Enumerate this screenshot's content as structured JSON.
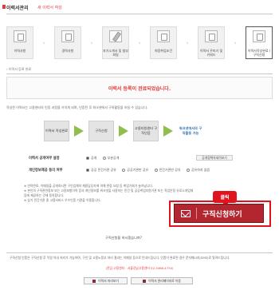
{
  "header": {
    "title": "이력서관리",
    "subtitle": "새 이력서 작성"
  },
  "steps": [
    {
      "label": "이력사항"
    },
    {
      "label": "경력사항"
    },
    {
      "label": "자기소개서 및 첨부파일"
    },
    {
      "label": "희망취업조건"
    },
    {
      "label": "이력서 꾸미기 및 키워드"
    },
    {
      "label": "이력서작성완료 /구직신청"
    }
  ],
  "sub_note": "› 이력서 등록 완료",
  "done_message": "이력서 등록이 완료되었습니다.",
  "info_line": "작성된 이력서는 고용센터의 인증 과정을 거치게 되며, 인증된 후 워크넷에서 구직활동을 하실 수 있습니다.",
  "pipeline": [
    "이력서 작성완료",
    "구직신청",
    "고용지원센터 구직인증",
    "워크넷에서의 구직활동 가능"
  ],
  "form": {
    "public_label": "이력서 공개여부 설정",
    "public_options": [
      "공개",
      "부분공개"
    ],
    "view_button": "공개정책자세히보기",
    "privacy_label": "개인정보제공 동의 여부",
    "privacy_options": [
      "공공 민간기관 공유",
      "공공기관만 공유",
      "민간기관만 공유",
      "공유하지 않음"
    ]
  },
  "notes": [
    "※ 연락번호, 이메일을 공개하시면 구인업체의 채용담당자에 의해 면접 요청 등 취업기회가 늘어납니다.",
    "※ 본인의 구직관련정보 또는 고용보험이력 등의 개인정보를 워크넷을 사용하는 민간 및 공공취업지원기관 또는 직업안정 유료소개업체 등에 제공하는 것에 동의합니다.",
    "※ 상기 민간기관 중 고용서비스 우수인증 기관을 이용합니다."
  ],
  "ask_text": "구직신청을 하시겠습니까?",
  "callout": "클릭",
  "apply_button": "구직신청하기",
  "bottom_info": "구직신청 인증은 구직신청 후 익일 이내 처리가 가능하며, 구인 및 고용노동부 처리 결과는 이메일 등으로 안내드립니다. 인증이 완료된 경우 문자메시지(SMS)로 알려드립니다.",
  "bottom_red": "(전담 고용센터 : 서울강남고용센터 02-3468-4734)",
  "footer_buttons": [
    "이력서 미리보기",
    "이력서 관리페이지로 이동"
  ]
}
